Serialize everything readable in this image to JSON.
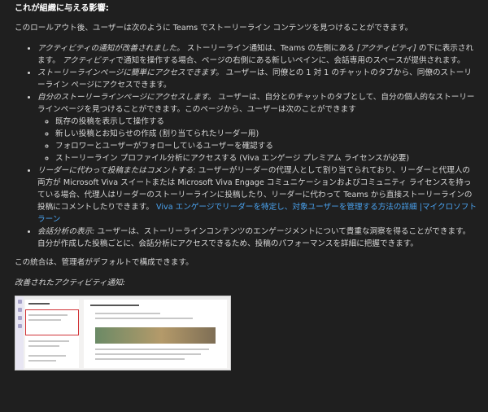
{
  "heading": "これが組織に与える影響:",
  "intro": "このロールアウト後、ユーザーは次のように Teams でストーリーライン コンテンツを見つけることができます。",
  "items": [
    {
      "lead": "アクティビティの通知が改善されました。",
      "mid_a": " ストーリーライン通知は、Teams の左側にある ",
      "mid_em": "[アクティビティ]",
      "mid_b": " の下に表示されます。 ",
      "tail_em": "アクティビティ",
      "tail": "で通知を操作する場合、ページの右側にある新しいペインに、会話専用のスペースが提供されます。"
    },
    {
      "lead": "ストーリーラインページに簡単にアクセスできます。",
      "text": " ユーザーは、同僚との 1 対 1 のチャットのタブから、同僚のストーリーライン ページにアクセスできます。"
    },
    {
      "lead": "自分のストーリーラインページにアクセスします。",
      "text": " ユーザーは、自分とのチャットのタブとして、自分の個人的なストーリーラインページを見つけることができます。このページから、ユーザーは次のことができます",
      "sub": [
        "既存の投稿を表示して操作する",
        "新しい投稿とお知らせの作成 (割り当てられたリーダー用)",
        "フォロワーとユーザーがフォローしているユーザーを確認する",
        "ストーリーライン プロファイル分析にアクセスする (Viva エンゲージ プレミアム ライセンスが必要)"
      ]
    },
    {
      "lead": "リーダーに代わって投稿またはコメントする:",
      "text": " ユーザーがリーダーの代理人として割り当てられており、リーダーと代理人の両方が Microsoft Viva スイートまたは Microsoft Viva Engage コミュニケーションおよびコミュニティ ライセンスを持っている場合、代理人はリーダーのストーリーラインに投稿したり、リーダーに代わって Teams から直接ストーリーラインの投稿にコメントしたりできます。",
      "link": "Viva エンゲージでリーダーを特定し、対象ユーザーを管理する方法の詳細 |マイクロソフト ラーン"
    },
    {
      "lead": "会話分析の表示:",
      "text": " ユーザーは、ストーリーラインコンテンツのエンゲージメントについて貴重な洞察を得ることができます。自分が作成した投稿ごとに、会話分析にアクセスできるため、投稿のパフォーマンスを詳細に把握できます。"
    }
  ],
  "outro": "この統合は、管理者がデフォルトで構成できます。",
  "caption": "改善されたアクティビティ通知:",
  "colors": {
    "background": "#1f1f1f",
    "text": "#d6d6d6",
    "link": "#4aa3f0",
    "highlight": "#d13438"
  }
}
